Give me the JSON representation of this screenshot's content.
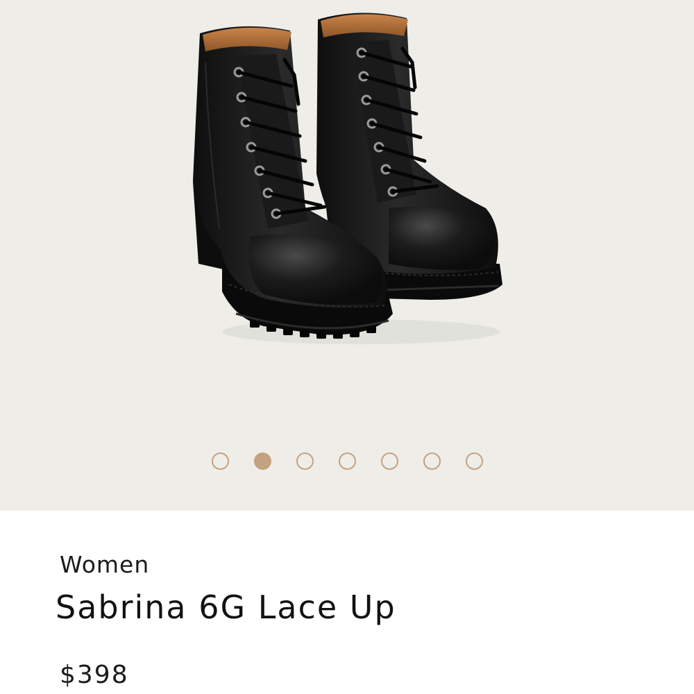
{
  "gallery": {
    "image_alt": "black lace-up heeled boots",
    "dots_total": 7,
    "active_index": 1,
    "dots": [
      {
        "label": ""
      },
      {
        "label": ""
      },
      {
        "label": ""
      },
      {
        "label": ""
      },
      {
        "label": ""
      },
      {
        "label": ""
      },
      {
        "label": ""
      }
    ]
  },
  "product": {
    "category": "Women",
    "title": "Sabrina 6G Lace Up",
    "price": "$398"
  },
  "colors": {
    "gallery_bg": "#eeede8",
    "dot_accent": "#c4a27f",
    "boot_black": "#141414",
    "lining_tan": "#b8743c"
  }
}
